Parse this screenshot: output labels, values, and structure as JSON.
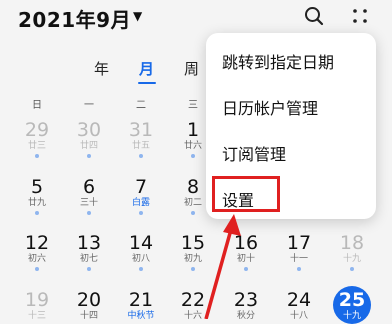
{
  "header": {
    "month_title": "2021年9月",
    "caret": "▼",
    "search_icon": "search-icon",
    "more_icon": "more-dots-icon"
  },
  "view_tabs": [
    "年",
    "月",
    "周"
  ],
  "active_tab": "月",
  "weekdays": [
    "日",
    "一",
    "二",
    "三"
  ],
  "calendar": {
    "rows": [
      [
        {
          "num": "29",
          "lunar": "廿三",
          "gray": true
        },
        {
          "num": "30",
          "lunar": "廿四",
          "gray": true
        },
        {
          "num": "31",
          "lunar": "廿五",
          "gray": true
        },
        {
          "num": "1",
          "lunar": "廿六"
        }
      ],
      [
        {
          "num": "5",
          "lunar": "廿九"
        },
        {
          "num": "6",
          "lunar": "三十"
        },
        {
          "num": "7",
          "lunar": "白露",
          "term": true
        },
        {
          "num": "8",
          "lunar": "初二"
        }
      ],
      [
        {
          "num": "12",
          "lunar": "初六"
        },
        {
          "num": "13",
          "lunar": "初七"
        },
        {
          "num": "14",
          "lunar": "初八"
        },
        {
          "num": "15",
          "lunar": "初九"
        },
        {
          "num": "16",
          "lunar": "初十"
        },
        {
          "num": "17",
          "lunar": "十一"
        },
        {
          "num": "18",
          "lunar": "十九",
          "gray": true
        }
      ],
      [
        {
          "num": "19",
          "lunar": "十三",
          "gray": true
        },
        {
          "num": "20",
          "lunar": "十四"
        },
        {
          "num": "21",
          "lunar": "中秋节",
          "term": true
        },
        {
          "num": "22",
          "lunar": "十六"
        },
        {
          "num": "23",
          "lunar": "秋分"
        },
        {
          "num": "24",
          "lunar": "十八"
        },
        {
          "num": "25",
          "lunar": "十九",
          "today": true
        }
      ]
    ]
  },
  "menu": {
    "items": [
      "跳转到指定日期",
      "日历帐户管理",
      "订阅管理",
      "设置"
    ],
    "highlighted_item": "设置"
  },
  "colors": {
    "accent": "#1769e8",
    "highlight": "#e02020",
    "background": "#f4f4f4"
  }
}
